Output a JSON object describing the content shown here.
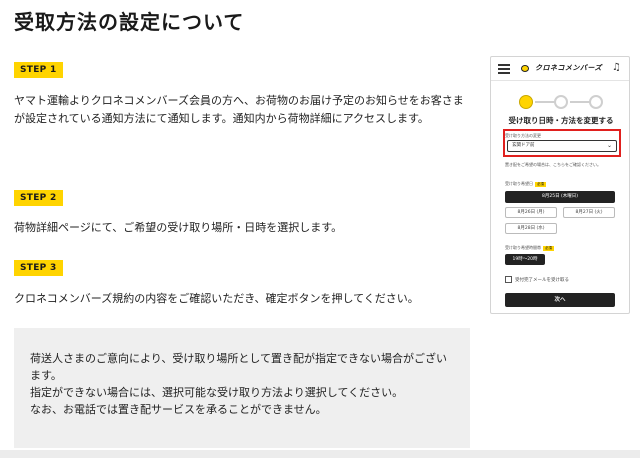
{
  "page": {
    "title": "受取方法の設定について"
  },
  "steps": [
    {
      "label": "STEP 1",
      "text": "ヤマト運輸よりクロネコメンバーズ会員の方へ、お荷物のお届け予定のお知らせをお客さまが設定されている通知方法にて通知します。通知内から荷物詳細にアクセスします。"
    },
    {
      "label": "STEP 2",
      "text": "荷物詳細ページにて、ご希望の受け取り場所・日時を選択します。"
    },
    {
      "label": "STEP 3",
      "text": "クロネコメンバーズ規約の内容をご確認いただき、確定ボタンを押してください。"
    }
  ],
  "note": {
    "line1": "荷送人さまのご意向により、受け取り場所として置き配が指定できない場合がございます。",
    "line2": "指定ができない場合には、選択可能な受け取り方法より選択してください。",
    "line3": "なお、お電話では置き配サービスを承ることができません。"
  },
  "phone": {
    "brand": "クロネコメンバーズ",
    "bell_icon": "bell-icon",
    "menu_icon": "hamburger-menu-icon",
    "progress_steps": 3,
    "progress_active": 1,
    "title": "受け取り日時・方法を変更する",
    "method_label": "受け取り方法の変更",
    "method_value": "玄関ドア前",
    "method_note": "置き配をご希望の場合は、こちらをご確認ください。",
    "date_label": "受け取り希望日",
    "required_badge": "必須",
    "dates": [
      "8月25日 (木曜日)",
      "8月26日 (月)",
      "8月27日 (火)",
      "8月28日 (水)"
    ],
    "time_label": "受け取り希望時間帯",
    "time_value": "19時〜20時",
    "checkbox_label": "受付完了メールを受け取る",
    "next_button": "次へ"
  },
  "colors": {
    "accent_yellow": "#ffd400",
    "highlight_red": "#e0201e",
    "note_bg": "#efefef",
    "dark_button": "#222222"
  }
}
